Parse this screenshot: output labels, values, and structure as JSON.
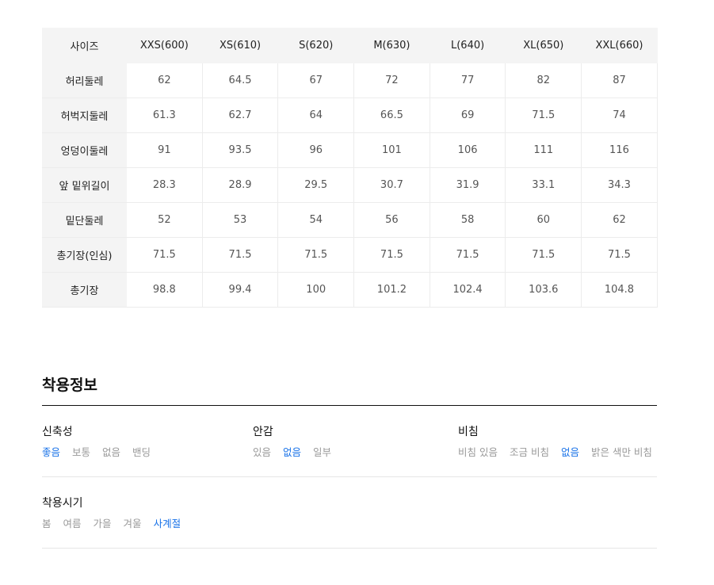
{
  "size_table": {
    "header": [
      "사이즈",
      "XXS(600)",
      "XS(610)",
      "S(620)",
      "M(630)",
      "L(640)",
      "XL(650)",
      "XXL(660)"
    ],
    "rows": [
      {
        "label": "허리둘레",
        "values": [
          "62",
          "64.5",
          "67",
          "72",
          "77",
          "82",
          "87"
        ]
      },
      {
        "label": "허벅지둘레",
        "values": [
          "61.3",
          "62.7",
          "64",
          "66.5",
          "69",
          "71.5",
          "74"
        ]
      },
      {
        "label": "엉덩이둘레",
        "values": [
          "91",
          "93.5",
          "96",
          "101",
          "106",
          "111",
          "116"
        ]
      },
      {
        "label": "앞 밑위길이",
        "values": [
          "28.3",
          "28.9",
          "29.5",
          "30.7",
          "31.9",
          "33.1",
          "34.3"
        ]
      },
      {
        "label": "밑단둘레",
        "values": [
          "52",
          "53",
          "54",
          "56",
          "58",
          "60",
          "62"
        ]
      },
      {
        "label": "총기장(인심)",
        "values": [
          "71.5",
          "71.5",
          "71.5",
          "71.5",
          "71.5",
          "71.5",
          "71.5"
        ]
      },
      {
        "label": "총기장",
        "values": [
          "98.8",
          "99.4",
          "100",
          "101.2",
          "102.4",
          "103.6",
          "104.8"
        ]
      }
    ]
  },
  "wear_info": {
    "title": "착용정보",
    "stretch": {
      "label": "신축성",
      "options": [
        "좋음",
        "보통",
        "없음",
        "밴딩"
      ],
      "selected": "좋음"
    },
    "lining": {
      "label": "안감",
      "options": [
        "있음",
        "없음",
        "일부"
      ],
      "selected": "없음"
    },
    "sheer": {
      "label": "비침",
      "options": [
        "비침 있음",
        "조금 비침",
        "없음",
        "밝은 색만 비침"
      ],
      "selected": "없음"
    },
    "season": {
      "label": "착용시기",
      "options": [
        "봄",
        "여름",
        "가을",
        "겨울",
        "사계절"
      ],
      "selected": "사계절"
    }
  },
  "colors": {
    "active": "#1a73e8",
    "inactive": "#999999",
    "header_bg": "#f4f4f4"
  }
}
